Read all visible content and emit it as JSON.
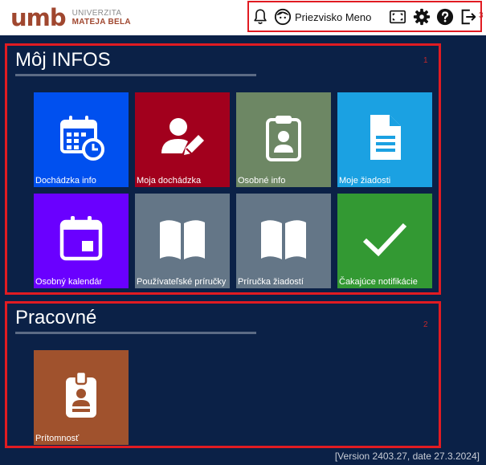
{
  "header": {
    "logo_mark": "umb",
    "logo_line1": "UNIVERZITA",
    "logo_line2": "MATEJA BELA",
    "user_name": "Priezvisko Meno",
    "region_label": "3",
    "icons": [
      "bell-icon",
      "user-avatar-icon",
      "fullscreen-icon",
      "gear-icon",
      "help-icon",
      "logout-icon"
    ]
  },
  "sections": [
    {
      "title": "Môj INFOS",
      "region_label": "1",
      "tiles": [
        {
          "label": "Dochádzka info",
          "color": "#0050ef",
          "icon": "calendar-clock-icon"
        },
        {
          "label": "Moja dochádzka",
          "color": "#a2001d",
          "icon": "user-edit-icon"
        },
        {
          "label": "Osobné info",
          "color": "#6d8764",
          "icon": "clipboard-user-icon"
        },
        {
          "label": "Moje žiadosti",
          "color": "#1ba1e2",
          "icon": "document-icon"
        },
        {
          "label": "Osobný kalendár",
          "color": "#6a00ff",
          "icon": "calendar-icon"
        },
        {
          "label": "Používateľské príručky",
          "color": "#647687",
          "icon": "book-icon"
        },
        {
          "label": "Príručka žiadostí",
          "color": "#647687",
          "icon": "book-icon"
        },
        {
          "label": "Čakajúce notifikácie",
          "color": "#339933",
          "icon": "checkmark-icon"
        }
      ]
    },
    {
      "title": "Pracovné",
      "region_label": "2",
      "tiles": [
        {
          "label": "Prítomnosť",
          "color": "#a0522d",
          "icon": "id-badge-icon"
        }
      ]
    }
  ],
  "footer": {
    "version": "[Version 2403.27, date 27.3.2024]"
  }
}
